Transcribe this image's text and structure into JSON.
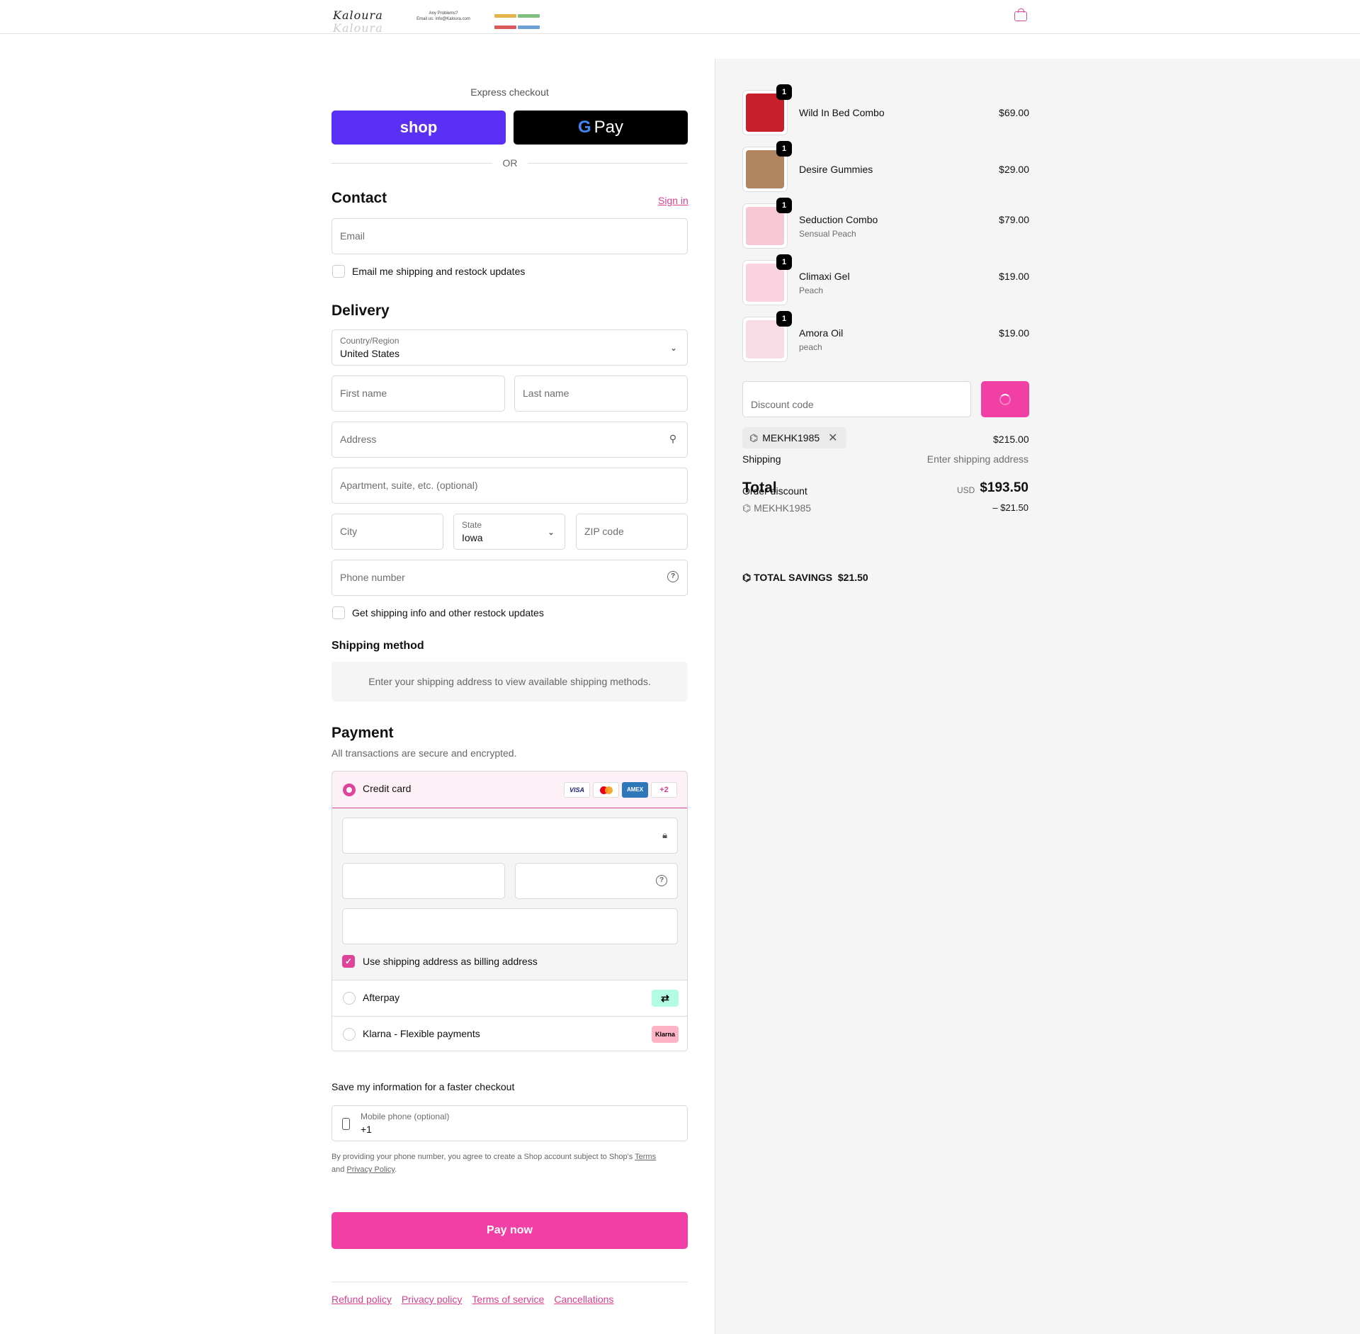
{
  "header": {
    "logo": "Kaloura",
    "banner_line1": "Any Problems?",
    "banner_line2": "Email us: info@Kaloura.com"
  },
  "express": {
    "title": "Express checkout",
    "shop_label": "shop",
    "gpay_g": "G",
    "gpay_label": "Pay",
    "or": "OR"
  },
  "contact": {
    "title": "Contact",
    "sign_in": "Sign in",
    "email_placeholder": "Email",
    "email_updates": "Email me shipping and restock updates"
  },
  "delivery": {
    "title": "Delivery",
    "country_label": "Country/Region",
    "country_value": "United States",
    "first_name": "First name",
    "last_name": "Last name",
    "address": "Address",
    "apartment": "Apartment, suite, etc. (optional)",
    "city": "City",
    "state_label": "State",
    "state_value": "Iowa",
    "zip": "ZIP code",
    "phone": "Phone number",
    "shipping_updates": "Get shipping info and other restock updates"
  },
  "shipping_method": {
    "title": "Shipping method",
    "message": "Enter your shipping address to view available shipping methods."
  },
  "payment": {
    "title": "Payment",
    "subtitle": "All transactions are secure and encrypted.",
    "credit_card": "Credit card",
    "cards": {
      "visa": "VISA",
      "amex": "AMEX",
      "more": "+2"
    },
    "billing_same": "Use shipping address as billing address",
    "afterpay": "Afterpay",
    "afterpay_logo": "⇄",
    "klarna": "Klarna - Flexible payments",
    "klarna_logo": "Klarna"
  },
  "save_info": {
    "title": "Save my information for a faster checkout",
    "mobile_label": "Mobile phone (optional)",
    "mobile_value": "+1",
    "legal_prefix": "By providing your phone number, you agree to create a Shop account subject to Shop's ",
    "terms": "Terms",
    "legal_and": "and ",
    "privacy": "Privacy Policy",
    "legal_suffix": "."
  },
  "pay_now": "Pay now",
  "footer": {
    "refund": "Refund policy",
    "privacy": "Privacy policy",
    "terms": "Terms of service",
    "cancellations": "Cancellations"
  },
  "order": {
    "items": [
      {
        "name": "Wild In Bed Combo",
        "variant": "",
        "price": "$69.00",
        "qty": "1",
        "color": "#c8202a"
      },
      {
        "name": "Desire Gummies",
        "variant": "",
        "price": "$29.00",
        "qty": "1",
        "color": "#b08560"
      },
      {
        "name": "Seduction Combo",
        "variant": "Sensual Peach",
        "price": "$79.00",
        "qty": "1",
        "color": "#f6c8d4"
      },
      {
        "name": "Climaxi Gel",
        "variant": "Peach",
        "price": "$19.00",
        "qty": "1",
        "color": "#f9d3df"
      },
      {
        "name": "Amora Oil",
        "variant": "peach",
        "price": "$19.00",
        "qty": "1",
        "color": "#f9dbe5"
      }
    ],
    "discount_placeholder": "Discount code",
    "code": "MEKHK1985",
    "subtotal": "$215.00",
    "shipping_label": "Shipping",
    "shipping_value": "Enter shipping address",
    "order_discount_label": "Order discount",
    "discount_code_line": "MEKHK1985",
    "discount_amount": "– $21.50",
    "total_label": "Total",
    "currency": "USD",
    "total": "$193.50",
    "savings_label": "TOTAL SAVINGS",
    "savings_value": "$21.50"
  },
  "colors": {
    "accent": "#f13fa5",
    "link": "#d6418f",
    "shop_pay": "#5a31f4"
  }
}
